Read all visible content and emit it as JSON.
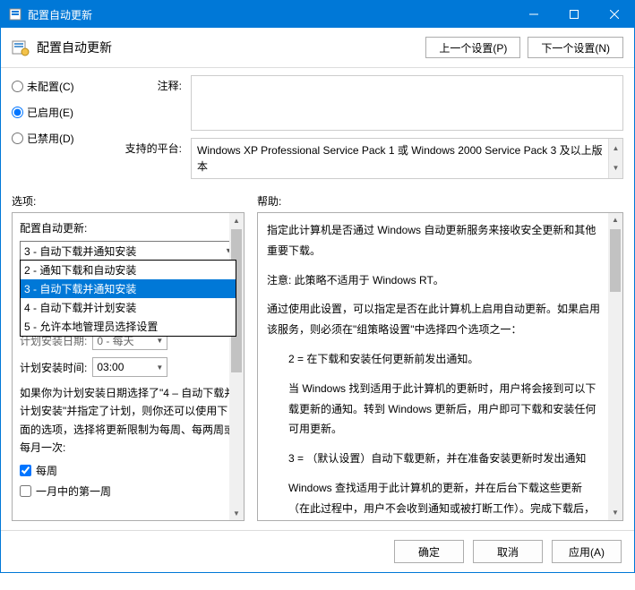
{
  "titlebar": {
    "title": "配置自动更新"
  },
  "header": {
    "title": "配置自动更新",
    "prev": "上一个设置(P)",
    "next": "下一个设置(N)"
  },
  "radios": {
    "not_configured": "未配置(C)",
    "enabled": "已启用(E)",
    "disabled": "已禁用(D)"
  },
  "comment_label": "注释:",
  "comment_value": "",
  "platform_label": "支持的平台:",
  "platform_value": "Windows XP Professional Service Pack 1 或 Windows 2000 Service Pack 3 及以上版本",
  "options_label": "选项:",
  "help_label": "帮助:",
  "options": {
    "config_label": "配置自动更新:",
    "selected": "3 - 自动下载并通知安装",
    "items": [
      "2 - 通知下载和自动安装",
      "3 - 自动下载并通知安装",
      "4 - 自动下载并计划安装",
      "5 - 允许本地管理员选择设置"
    ],
    "install_date_label": "计划安装日期:",
    "install_date_value": "0 - 每天",
    "install_time_label": "计划安装时间:",
    "install_time_value": "03:00",
    "note": "如果你为计划安装日期选择了\"4 – 自动下载并计划安装\"并指定了计划，则你还可以使用下面的选项，选择将更新限制为每周、每两周或每月一次:",
    "chk_weekly": "每周",
    "chk_first_week": "一月中的第一周"
  },
  "help": {
    "p1": "指定此计算机是否通过 Windows 自动更新服务来接收安全更新和其他重要下载。",
    "p2": "注意: 此策略不适用于 Windows RT。",
    "p3": "通过使用此设置，可以指定是否在此计算机上启用自动更新。如果启用该服务，则必须在\"组策略设置\"中选择四个选项之一：",
    "p4": "2 = 在下载和安装任何更新前发出通知。",
    "p5": "当 Windows 找到适用于此计算机的更新时，用户将会接到可以下载更新的通知。转到 Windows 更新后，用户即可下载和安装任何可用更新。",
    "p6": "3 = （默认设置）自动下载更新，并在准备安装更新时发出通知",
    "p7": "Windows 查找适用于此计算机的更新，并在后台下载这些更新（在此过程中，用户不会收到通知或被打断工作）。完成下载后，用户将收到可以安装更新的通知。转到 Windows 更新后，用户即可安装更新。"
  },
  "footer": {
    "ok": "确定",
    "cancel": "取消",
    "apply": "应用(A)"
  }
}
